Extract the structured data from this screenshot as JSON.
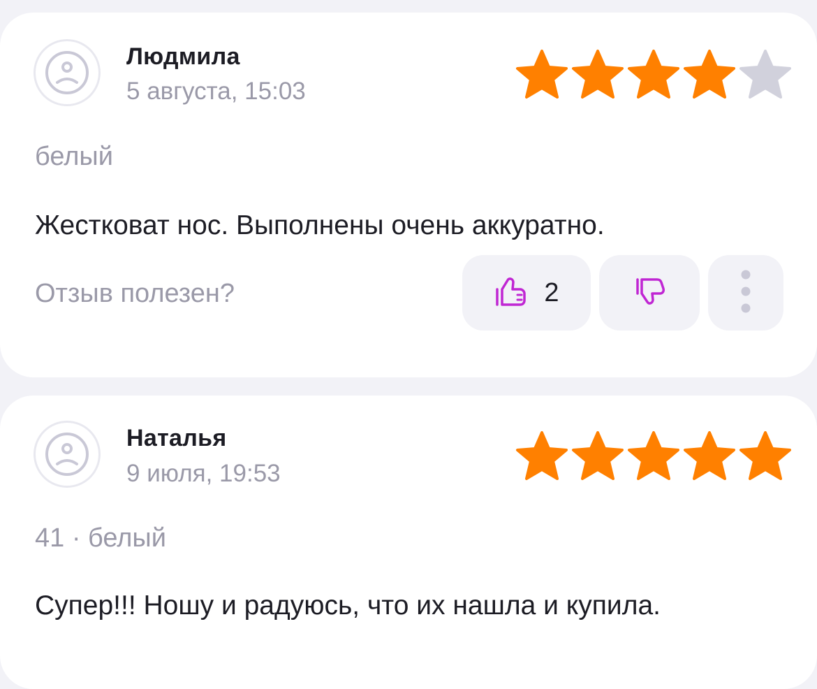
{
  "reviews": [
    {
      "author": "Людмила",
      "date": "5 августа, 15:03",
      "rating": 4,
      "max_rating": 5,
      "variant": "белый",
      "text": "Жестковат нос. Выполнены очень аккуратно.",
      "helpful_question": "Отзыв полезен?",
      "likes": "2"
    },
    {
      "author": "Наталья",
      "date": "9 июля, 19:53",
      "rating": 5,
      "max_rating": 5,
      "variant": "41 · белый",
      "text": "Супер!!! Ношу и радуюсь, что их нашла и купила."
    }
  ],
  "colors": {
    "background": "#f2f2f7",
    "card": "#ffffff",
    "star_filled": "#ff8000",
    "star_empty": "#d1d1dc",
    "accent_purple": "#c026d3",
    "text_primary": "#1c1c24",
    "text_secondary": "#9a99a8"
  },
  "icons": {
    "avatar": "sad-face-icon",
    "like": "thumbs-up-icon",
    "dislike": "thumbs-down-icon",
    "more": "more-vertical-icon",
    "star": "star-icon"
  }
}
